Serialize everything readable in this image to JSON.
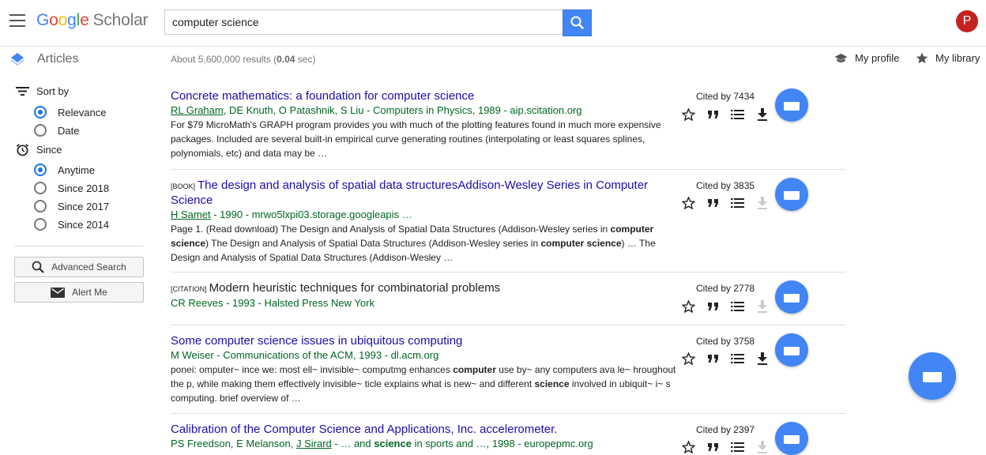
{
  "header": {
    "logo_google": "Google",
    "logo_scholar": "Scholar",
    "search_value": "computer science",
    "avatar_letter": "P",
    "colors": {
      "accent": "#4285f4",
      "avatar": "#c5221f",
      "link": "#1a0dab",
      "green": "#006621"
    }
  },
  "subbar": {
    "section": "Articles",
    "results_prefix": "About 5,600,000 results (",
    "results_time": "0.04",
    "results_suffix": " sec)",
    "my_profile": "My profile",
    "my_library": "My library"
  },
  "sidebar": {
    "sort_label": "Sort by",
    "sort_options": [
      {
        "label": "Relevance",
        "selected": true
      },
      {
        "label": "Date",
        "selected": false
      }
    ],
    "since_label": "Since",
    "since_options": [
      {
        "label": "Anytime",
        "selected": true
      },
      {
        "label": "Since 2018",
        "selected": false
      },
      {
        "label": "Since 2017",
        "selected": false
      },
      {
        "label": "Since 2014",
        "selected": false
      }
    ],
    "advanced_search": "Advanced Search",
    "alert_me": "Alert Me"
  },
  "results": [
    {
      "badge": "",
      "title_parts": [
        "Concrete mathematics: a foundation for ",
        "computer science",
        ""
      ],
      "authors_linked": "RL Graham",
      "authors_rest": ", DE Knuth, O Patashnik, S Liu - Computers in Physics, 1989 - aip.scitation.org",
      "snippet_html_parts": [
        "For $79 MicroMath's GRAPH program provides you with much of the plotting features found in much more expensive packages. Included are several built-in empirical curve generating routines (interpolating or least squares splines, polynomials, etc) and data may be …"
      ],
      "cited": "Cited by 7434",
      "download_active": true
    },
    {
      "badge": "[BOOK]",
      "title_parts": [
        "The design and analysis of spatial data structuresAddison-Wesley Series in ",
        "Computer Science",
        ""
      ],
      "authors_linked": "H Samet",
      "authors_rest": " - 1990 - mrwo5lxpi03.storage.googleapis …",
      "snippet_parts": [
        "Page 1. (Read download) The Design and Analysis of Spatial Data Structures (Addison-Wesley series in ",
        "computer science",
        ") The Design and Analysis of Spatial Data Structures (Addison-Wesley series in ",
        "computer science",
        ") … The Design and Analysis of Spatial Data Structures (Addison-Wesley …"
      ],
      "cited": "Cited by 3835",
      "download_active": false
    },
    {
      "badge": "[CITATION]",
      "title": "Modern heuristic techniques for combinatorial problems",
      "authors_rest": "CR Reeves - 1993 - Halsted Press New York",
      "cited": "Cited by 2778",
      "download_active": false
    },
    {
      "badge": "",
      "title_parts": [
        "Some ",
        "computer science",
        " issues in ubiquitous computing"
      ],
      "authors_rest": "M Weiser - Communications of the ACM, 1993 - dl.acm.org",
      "snippet_parts": [
        "ponei: omputer~ ince we: most ell~ invisible~ computmg enhances ",
        "computer",
        " use by~ any computers ava le~ hroughout the p, while making them effectlvely invisible~ ticle explains what is new~ and different ",
        "science",
        " involved in ubiquit~ i~ s computing. brief overview of …"
      ],
      "cited": "Cited by 3758",
      "download_active": true
    },
    {
      "badge": "",
      "title_parts": [
        "Calibration of the ",
        "Computer Science",
        " and Applications, Inc. accelerometer."
      ],
      "authors_pre": "PS Freedson, E Melanson, ",
      "authors_linked": "J Sirard",
      "authors_rest": " - … and ",
      "authors_bold": "science",
      "authors_tail": " in sports and …, 1998 - europepmc.org",
      "cited": "Cited by 2397",
      "download_active": false
    }
  ]
}
